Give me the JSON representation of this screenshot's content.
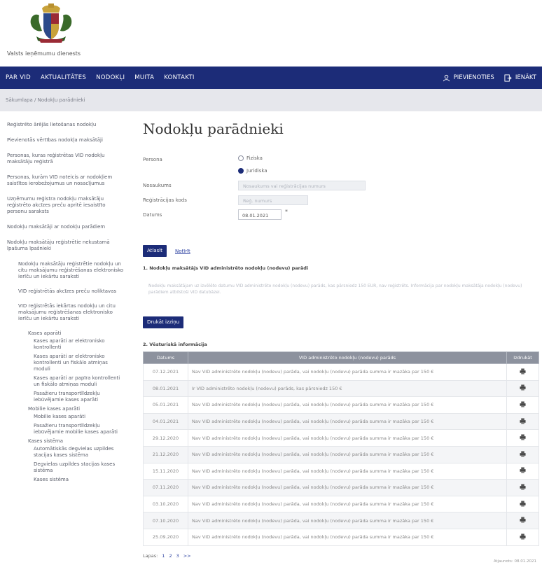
{
  "header": {
    "org_name": "Valsts ieņēmumu dienests"
  },
  "nav": {
    "items": [
      "PAR VID",
      "AKTUALITĀTES",
      "NODOKĻI",
      "MUITA",
      "KONTAKTI"
    ],
    "right": [
      "PIEVIENOTIES",
      "IENĀKT"
    ]
  },
  "breadcrumb": "Sākumlapa / Nodokļu parādnieki",
  "sidebar": {
    "items": [
      {
        "label": "Reģistrēto ārējās lietošanas nodokļu",
        "level": 0
      },
      {
        "label": "Pievienotās vērtības nodokļa maksātāji",
        "level": 0
      },
      {
        "label": "Personas, kuras reģistrētas VID nodokļu maksātāju reģistrā",
        "level": 0
      },
      {
        "label": "Personas, kurām VID noteicis ar nodokļiem saistītos ierobežojumus un nosacījumus",
        "level": 0
      },
      {
        "label": "Uzņēmumu reģistra nodokļu maksātāju reģistrēto akcīzes preču apritē iesaistīto personu saraksts",
        "level": 0
      },
      {
        "label": "Nodokļu maksātāji ar nodokļu parādiem",
        "level": 0
      },
      {
        "label": "Nodokļu maksātāju reģistrētie nekustamā īpašuma īpašnieki",
        "level": 0
      },
      {
        "label": "Nodokļu maksātāju reģistrētie nodokļu un citu maksājumu reģistrēšanas elektronisko ierīču un iekārtu saraksti",
        "level": 1
      },
      {
        "label": "VID reģistrētās akcīzes preču noliktavas",
        "level": 1
      },
      {
        "label": "VID reģistrētās iekārtas nodokļu un citu maksājumu reģistrēšanas elektronisko ierīču un iekārtu saraksti",
        "level": 1
      },
      {
        "label": "Kases aparāti",
        "level": 2
      },
      {
        "label": "Kases aparāti ar elektronisko kontrollenti",
        "level": 3
      },
      {
        "label": "Kases aparāti ar elektronisko kontrollenti un fiskālo atmiņas moduli",
        "level": 3
      },
      {
        "label": "Kases aparāti ar papīra kontrollenti un fiskālo atmiņas moduli",
        "level": 3
      },
      {
        "label": "Pasažieru transportlīdzekļu iebūvējamie kases aparāti",
        "level": 3
      },
      {
        "label": "Mobilie kases aparāti",
        "level": 2
      },
      {
        "label": "Mobilie kases aparāti",
        "level": 3
      },
      {
        "label": "Pasažieru transportlīdzekļu iebūvējamie mobilie kases aparāti",
        "level": 3
      },
      {
        "label": "Kases sistēma",
        "level": 2
      },
      {
        "label": "Automātiskās degvielas uzpildes stacijas kases sistēma",
        "level": 3
      },
      {
        "label": "Degvielas uzpildes stacijas kases sistēma",
        "level": 3
      },
      {
        "label": "Kases sistēma",
        "level": 3
      }
    ]
  },
  "main": {
    "title": "Nodokļu parādnieki",
    "form": {
      "persona_label": "Persona",
      "radio_1": "Fiziska",
      "radio_2": "Juridiska",
      "nosaukums_label": "Nosaukums",
      "nosaukums_value": "Nosaukums vai reģistrācijas numurs",
      "regnr_label": "Reģistrācijas kods",
      "regnr_value": "Reģ. numurs",
      "datums_label": "Datums",
      "datums_value": "08.01.2021",
      "datums_star": "*"
    },
    "atlasit_button": "Atlasīt",
    "notirit_link": "Notīrīt",
    "section1": "1. Nodokļu maksātājs VID administrēto nodokļu (nodevu) parādi",
    "section1_text": "Nodokļu maksātājam uz izvēlēto datumu VID administrēto nodokļu (nodevu) parāds, kas pārsniedz 150 EUR, nav reģistrēts. Informācija par nodokļu maksātāja nodokļu (nodevu) parādiem atbilstoši VID datubāzei.",
    "druka_button": "Drukāt izziņu",
    "section2": "2. Vēsturiskā informācija",
    "table": {
      "headers": [
        "Datums",
        "VID administrēto nodokļu (nodevu) parāds",
        "Izdrukāt"
      ],
      "rows": [
        {
          "date": "07.12.2021",
          "text": "Nav VID administrēto nodokļu (nodevu) parāda, vai nodokļu (nodevu) parāda summa ir mazāka par 150 €"
        },
        {
          "date": "08.01.2021",
          "text": "Ir VID administrēto nodokļu (nodevu) parāds, kas pārsniedz 150 €"
        },
        {
          "date": "05.01.2021",
          "text": "Nav VID administrēto nodokļu (nodevu) parāda, vai nodokļu (nodevu) parāda summa ir mazāka par 150 €"
        },
        {
          "date": "04.01.2021",
          "text": "Nav VID administrēto nodokļu (nodevu) parāda, vai nodokļu (nodevu) parāda summa ir mazāka par 150 €"
        },
        {
          "date": "29.12.2020",
          "text": "Nav VID administrēto nodokļu (nodevu) parāda, vai nodokļu (nodevu) parāda summa ir mazāka par 150 €"
        },
        {
          "date": "21.12.2020",
          "text": "Nav VID administrēto nodokļu (nodevu) parāda, vai nodokļu (nodevu) parāda summa ir mazāka par 150 €"
        },
        {
          "date": "15.11.2020",
          "text": "Nav VID administrēto nodokļu (nodevu) parāda, vai nodokļu (nodevu) parāda summa ir mazāka par 150 €"
        },
        {
          "date": "07.11.2020",
          "text": "Nav VID administrēto nodokļu (nodevu) parāda, vai nodokļu (nodevu) parāda summa ir mazāka par 150 €"
        },
        {
          "date": "03.10.2020",
          "text": "Nav VID administrēto nodokļu (nodevu) parāda, vai nodokļu (nodevu) parāda summa ir mazāka par 150 €"
        },
        {
          "date": "07.10.2020",
          "text": "Nav VID administrēto nodokļu (nodevu) parāda, vai nodokļu (nodevu) parāda summa ir mazāka par 150 €"
        },
        {
          "date": "25.09.2020",
          "text": "Nav VID administrēto nodokļu (nodevu) parāda, vai nodokļu (nodevu) parāda summa ir mazāka par 150 €"
        }
      ]
    },
    "pager": {
      "label": "Lapas:",
      "pages": [
        "1",
        "2",
        "3",
        ">>"
      ]
    },
    "footer_note": "Atjaunots: 08.01.2021"
  },
  "colors": {
    "nav_bg": "#1c2c78",
    "table_header": "#8d929e",
    "crumb_bg": "#e6e7ec"
  },
  "icons": [
    "coat-of-arms",
    "user-icon",
    "login-icon",
    "print-icon"
  ]
}
